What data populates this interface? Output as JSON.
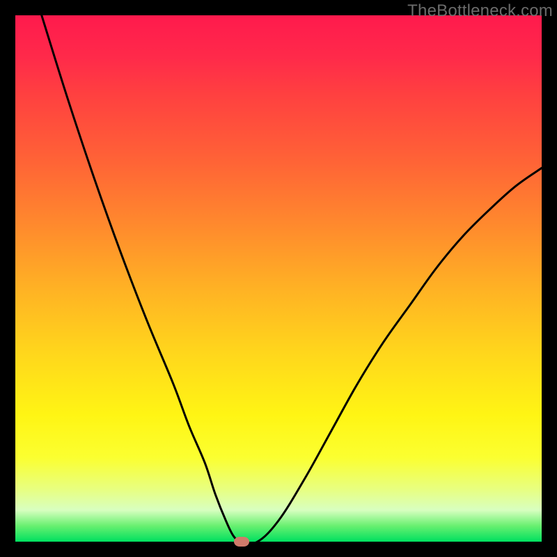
{
  "watermark": "TheBottleneck.com",
  "chart_data": {
    "type": "line",
    "title": "",
    "xlabel": "",
    "ylabel": "",
    "xlim": [
      0,
      100
    ],
    "ylim": [
      0,
      100
    ],
    "grid": false,
    "legend": false,
    "series": [
      {
        "name": "curve",
        "x": [
          5,
          10,
          15,
          20,
          25,
          30,
          33,
          36,
          38,
          40,
          41.5,
          43,
          46,
          50,
          55,
          60,
          65,
          70,
          75,
          80,
          85,
          90,
          95,
          100
        ],
        "y": [
          100,
          84,
          69,
          55,
          42,
          30,
          22,
          15,
          9,
          4,
          1,
          0,
          0,
          4,
          12,
          21,
          30,
          38,
          45,
          52,
          58,
          63,
          67.5,
          71
        ]
      }
    ],
    "marker": {
      "x": 43,
      "y": 0,
      "color": "#d07a6a"
    },
    "background_gradient": {
      "top": "#ff1a4d",
      "mid": "#ffd61c",
      "bottom": "#00e060"
    },
    "curve_color": "#000000",
    "curve_width": 3
  }
}
